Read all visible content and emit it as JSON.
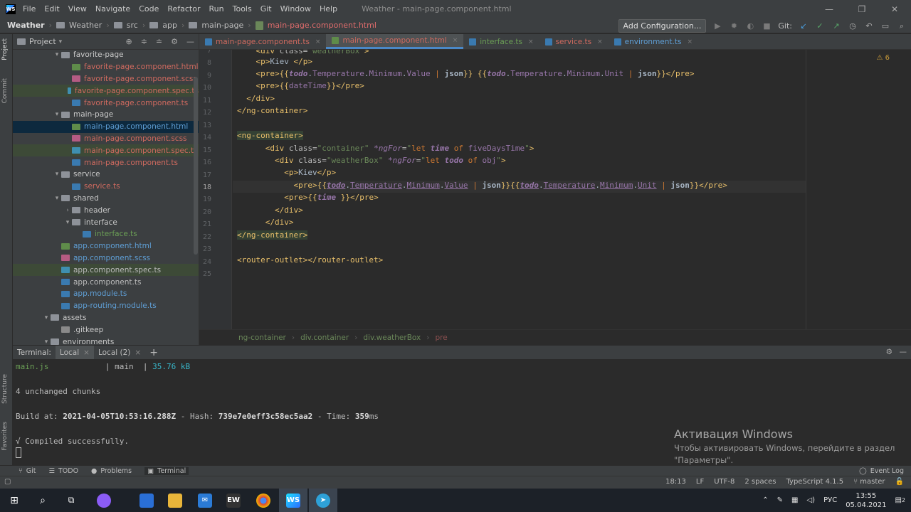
{
  "titlebar": {
    "menu": [
      "File",
      "Edit",
      "View",
      "Navigate",
      "Code",
      "Refactor",
      "Run",
      "Tools",
      "Git",
      "Window",
      "Help"
    ],
    "title": "Weather - main-page.component.html",
    "controls": [
      "—",
      "❐",
      "✕"
    ]
  },
  "navbar": {
    "crumbs": [
      "Weather",
      "Weather",
      "src",
      "app",
      "main-page"
    ],
    "active_file": "main-page.component.html",
    "add_config": "Add Configuration...",
    "git_label": "Git:"
  },
  "leftstripe": {
    "project": "Project",
    "commit": "Commit",
    "structure": "Structure",
    "favorites": "Favorites"
  },
  "project": {
    "title": "Project",
    "rows": [
      {
        "indent": 4,
        "arrow": "▾",
        "icon": "dir",
        "label": "favorite-page",
        "color": "white"
      },
      {
        "indent": 5,
        "arrow": "",
        "icon": "html",
        "label": "favorite-page.component.html",
        "color": "red"
      },
      {
        "indent": 5,
        "arrow": "",
        "icon": "scss",
        "label": "favorite-page.component.scss",
        "color": "red"
      },
      {
        "indent": 5,
        "arrow": "",
        "icon": "spec",
        "label": "favorite-page.component.spec.ts",
        "color": "red",
        "sel": "green"
      },
      {
        "indent": 5,
        "arrow": "",
        "icon": "ts",
        "label": "favorite-page.component.ts",
        "color": "red"
      },
      {
        "indent": 4,
        "arrow": "▾",
        "icon": "dir",
        "label": "main-page",
        "color": "white"
      },
      {
        "indent": 5,
        "arrow": "",
        "icon": "html",
        "label": "main-page.component.html",
        "color": "blue",
        "sel": "blue"
      },
      {
        "indent": 5,
        "arrow": "",
        "icon": "scss",
        "label": "main-page.component.scss",
        "color": "red"
      },
      {
        "indent": 5,
        "arrow": "",
        "icon": "spec",
        "label": "main-page.component.spec.ts",
        "color": "red",
        "sel": "green"
      },
      {
        "indent": 5,
        "arrow": "",
        "icon": "ts",
        "label": "main-page.component.ts",
        "color": "red"
      },
      {
        "indent": 4,
        "arrow": "▾",
        "icon": "dir",
        "label": "service",
        "color": "white"
      },
      {
        "indent": 5,
        "arrow": "",
        "icon": "ts",
        "label": "service.ts",
        "color": "red"
      },
      {
        "indent": 4,
        "arrow": "▾",
        "icon": "dir",
        "label": "shared",
        "color": "white"
      },
      {
        "indent": 5,
        "arrow": "›",
        "icon": "dir",
        "label": "header",
        "color": "white"
      },
      {
        "indent": 5,
        "arrow": "▾",
        "icon": "dir",
        "label": "interface",
        "color": "white"
      },
      {
        "indent": 6,
        "arrow": "",
        "icon": "ts",
        "label": "interface.ts",
        "color": "green"
      },
      {
        "indent": 4,
        "arrow": "",
        "icon": "html",
        "label": "app.component.html",
        "color": "blue"
      },
      {
        "indent": 4,
        "arrow": "",
        "icon": "scss",
        "label": "app.component.scss",
        "color": "blue"
      },
      {
        "indent": 4,
        "arrow": "",
        "icon": "spec",
        "label": "app.component.spec.ts",
        "color": "norm",
        "sel": "green"
      },
      {
        "indent": 4,
        "arrow": "",
        "icon": "ts",
        "label": "app.component.ts",
        "color": "norm"
      },
      {
        "indent": 4,
        "arrow": "",
        "icon": "ts",
        "label": "app.module.ts",
        "color": "blue"
      },
      {
        "indent": 4,
        "arrow": "",
        "icon": "ts",
        "label": "app-routing.module.ts",
        "color": "blue"
      },
      {
        "indent": 3,
        "arrow": "▾",
        "icon": "dir",
        "label": "assets",
        "color": "white"
      },
      {
        "indent": 4,
        "arrow": "",
        "icon": "plain",
        "label": ".gitkeep",
        "color": "white"
      },
      {
        "indent": 3,
        "arrow": "▾",
        "icon": "dir",
        "label": "environments",
        "color": "white"
      }
    ]
  },
  "tabs": [
    {
      "label": "main-page.component.ts",
      "color": "red",
      "icon": "ts",
      "active": false
    },
    {
      "label": "main-page.component.html",
      "color": "red",
      "icon": "html",
      "active": true
    },
    {
      "label": "interface.ts",
      "color": "green",
      "icon": "ts",
      "active": false
    },
    {
      "label": "service.ts",
      "color": "red",
      "icon": "ts",
      "active": false
    },
    {
      "label": "environment.ts",
      "color": "blue",
      "icon": "ts",
      "active": false
    }
  ],
  "editor": {
    "warnings": "⚠ 6",
    "line_numbers": [
      "7",
      "8",
      "9",
      "10",
      "11",
      "12",
      "13",
      "14",
      "15",
      "16",
      "17",
      "18",
      "19",
      "20",
      "21",
      "22",
      "23",
      "24",
      "25"
    ],
    "current_line": "18"
  },
  "breadcrumb": [
    "ng-container",
    "div.container",
    "div.weatherBox",
    "pre"
  ],
  "terminal": {
    "label": "Terminal:",
    "tabs": [
      "Local",
      "Local (2)"
    ],
    "add": "+",
    "line1_name": "main.js",
    "line1_sep1": "|",
    "line1_chunk": "main",
    "line1_sep2": "|",
    "line1_size": "35.76 kB",
    "line2": "4 unchanged chunks",
    "build_prefix": "Build at: ",
    "build_date": "2021-04-05T10:53:16.288Z",
    "hash_prefix": " - Hash: ",
    "hash": "739e7e0eff3c58ec5aa2",
    "time_prefix": " - Time: ",
    "time": "359",
    "time_unit": "ms",
    "compiled": "√ Compiled successfully."
  },
  "activation": {
    "title": "Активация Windows",
    "line1": "Чтобы активировать Windows, перейдите в раздел",
    "line2": "\"Параметры\"."
  },
  "toolstripe": [
    "Git",
    "TODO",
    "Problems",
    "Terminal"
  ],
  "toolstripe_right": "Event Log",
  "statusbar": [
    "18:13",
    "LF",
    "UTF-8",
    "2 spaces",
    "TypeScript 4.1.5",
    "master"
  ],
  "taskbar": {
    "tray_lang": "РУС",
    "time": "13:55",
    "date": "05.04.2021",
    "notif": "2"
  }
}
